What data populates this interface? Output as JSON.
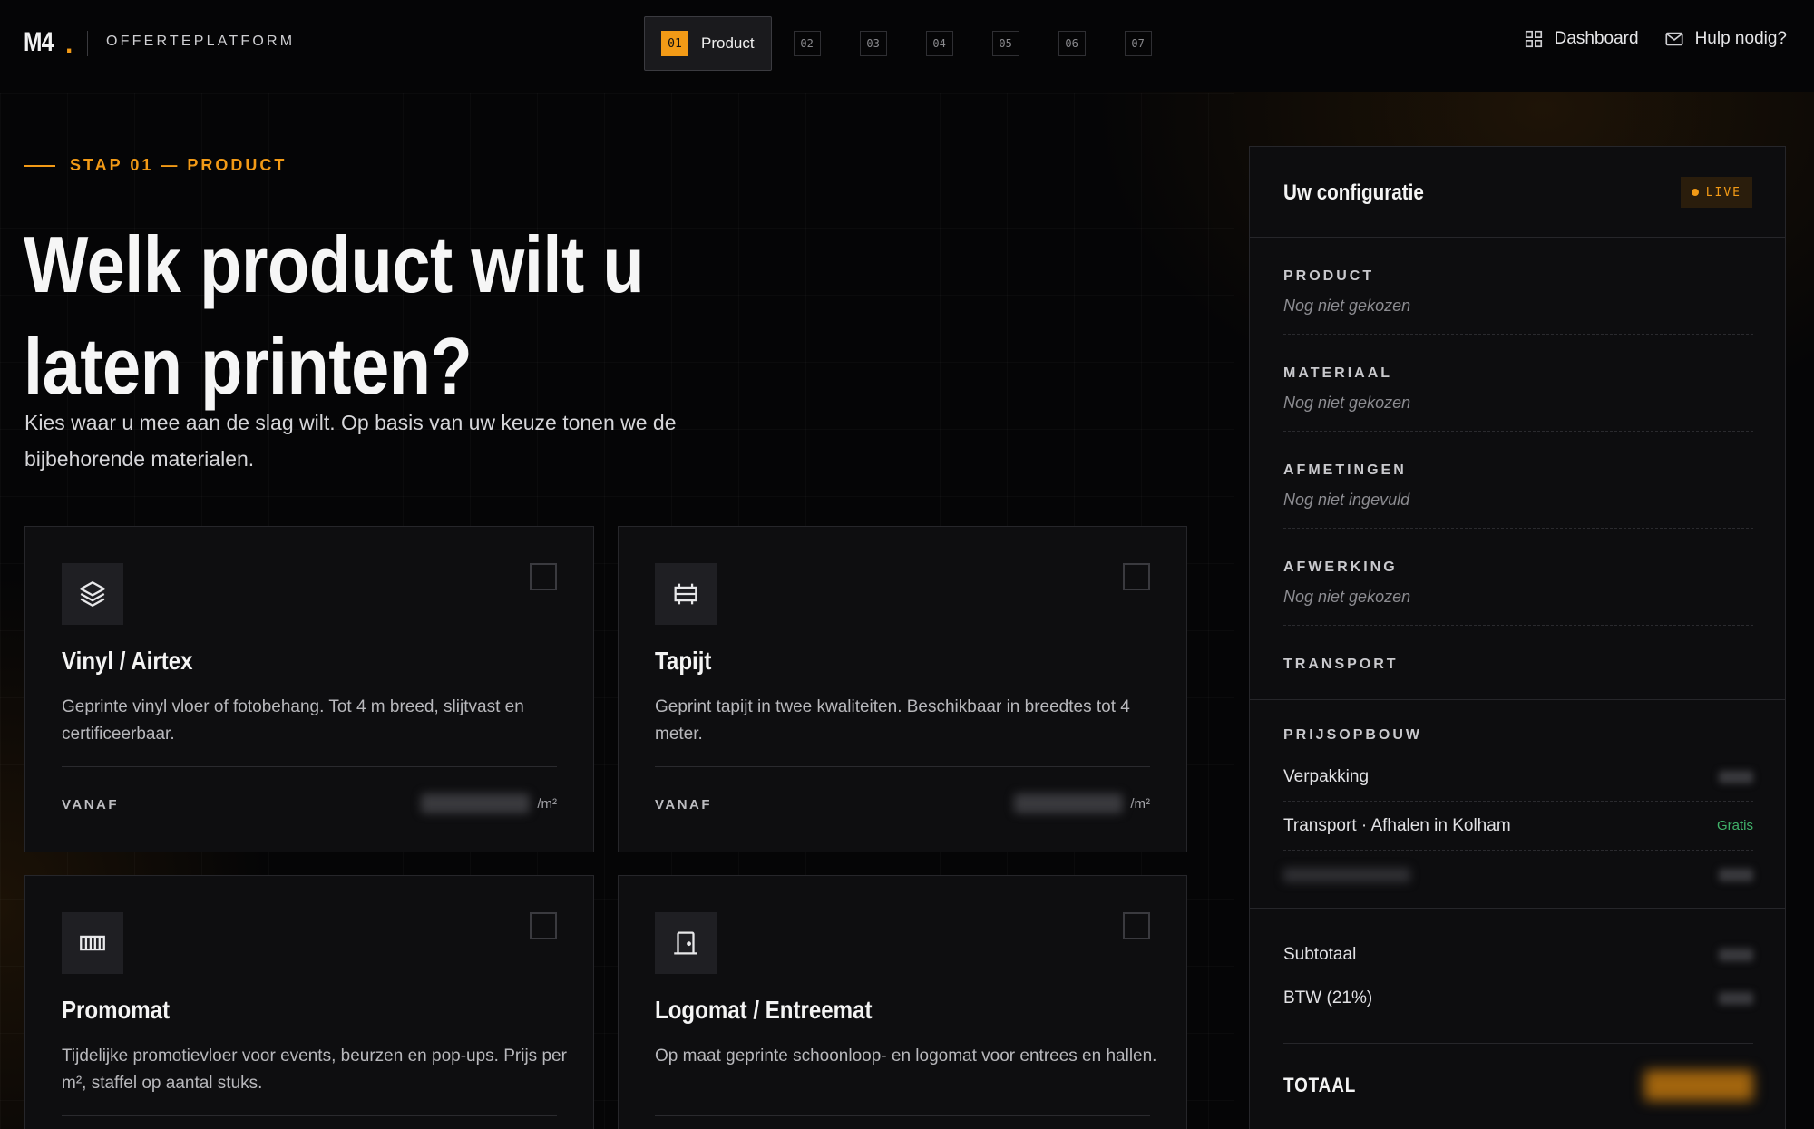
{
  "header": {
    "logo": "M4",
    "logo_dot": ".",
    "platform_name": "OFFERTEPLATFORM",
    "steps": [
      {
        "num": "01",
        "label": "Product",
        "active": true
      },
      {
        "num": "02"
      },
      {
        "num": "03"
      },
      {
        "num": "04"
      },
      {
        "num": "05"
      },
      {
        "num": "06"
      },
      {
        "num": "07"
      }
    ],
    "dashboard_label": "Dashboard",
    "help_label": "Hulp nodig?"
  },
  "hero": {
    "eyebrow": "STAP 01 — PRODUCT",
    "title_line1": "Welk product wilt u",
    "title_line2": "laten printen?",
    "subtitle": "Kies waar u mee aan de slag wilt. Op basis van uw keuze tonen we de bijbehorende materialen."
  },
  "products": [
    {
      "title": "Vinyl / Airtex",
      "description": "Geprinte vinyl vloer of fotobehang. Tot 4 m breed, slijtvast en certificeerbaar.",
      "from_label": "VANAF",
      "unit": "/m²",
      "icon": "layers-icon"
    },
    {
      "title": "Tapijt",
      "description": "Geprint tapijt in twee kwaliteiten. Beschikbaar in breedtes tot 4 meter.",
      "from_label": "VANAF",
      "unit": "/m²",
      "icon": "carpet-icon"
    },
    {
      "title": "Promomat",
      "description": "Tijdelijke promotievloer voor events, beurzen en pop-ups. Prijs per m², staffel op aantal stuks.",
      "icon": "mat-icon"
    },
    {
      "title": "Logomat / Entreemat",
      "description": "Op maat geprinte schoonloop- en logomat voor entrees en hallen.",
      "icon": "door-icon"
    }
  ],
  "config": {
    "title": "Uw configuratie",
    "live_label": "LIVE",
    "items": [
      {
        "label": "PRODUCT",
        "value": "Nog niet gekozen"
      },
      {
        "label": "MATERIAAL",
        "value": "Nog niet gekozen"
      },
      {
        "label": "AFMETINGEN",
        "value": "Nog niet ingevuld"
      },
      {
        "label": "AFWERKING",
        "value": "Nog niet gekozen"
      },
      {
        "label": "TRANSPORT",
        "value": ""
      }
    ],
    "price_heading": "PRIJSOPBOUW",
    "price_rows": [
      {
        "label": "Verpakking"
      },
      {
        "label": "Transport · Afhalen in Kolham",
        "value": "Gratis"
      }
    ],
    "subtotal_label": "Subtotaal",
    "vat_label": "BTW (21%)",
    "total_label": "TOTAAL"
  },
  "colors": {
    "accent": "#f29a16",
    "free_green": "#41b36a",
    "background": "#050506",
    "card": "#0e0e10"
  }
}
